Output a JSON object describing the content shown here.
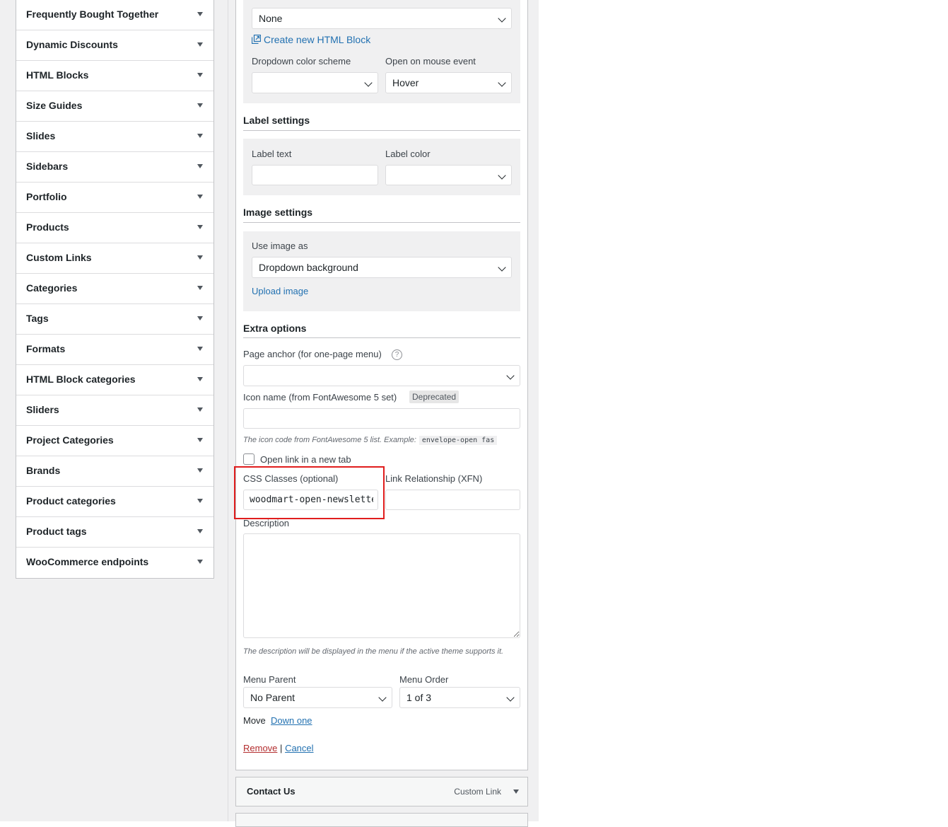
{
  "sidebar": {
    "items": [
      {
        "label": "Frequently Bought Together"
      },
      {
        "label": "Dynamic Discounts"
      },
      {
        "label": "HTML Blocks"
      },
      {
        "label": "Size Guides"
      },
      {
        "label": "Slides"
      },
      {
        "label": "Sidebars"
      },
      {
        "label": "Portfolio"
      },
      {
        "label": "Products"
      },
      {
        "label": "Custom Links"
      },
      {
        "label": "Categories"
      },
      {
        "label": "Tags"
      },
      {
        "label": "Formats"
      },
      {
        "label": "HTML Block categories"
      },
      {
        "label": "Sliders"
      },
      {
        "label": "Project Categories"
      },
      {
        "label": "Brands"
      },
      {
        "label": "Product categories"
      },
      {
        "label": "Product tags"
      },
      {
        "label": "WooCommerce endpoints"
      }
    ]
  },
  "menu_item": {
    "html_block_select": "None",
    "create_html_block": "Create new HTML Block",
    "dropdown_color_label": "Dropdown color scheme",
    "dropdown_color_value": "",
    "mouse_event_label": "Open on mouse event",
    "mouse_event_value": "Hover",
    "label_settings_title": "Label settings",
    "label_text_label": "Label text",
    "label_text_value": "",
    "label_color_label": "Label color",
    "label_color_value": "",
    "image_settings_title": "Image settings",
    "use_image_label": "Use image as",
    "use_image_value": "Dropdown background",
    "upload_image": "Upload image",
    "extra_options_title": "Extra options",
    "page_anchor_label": "Page anchor (for one-page menu)",
    "help_glyph": "?",
    "page_anchor_value": "",
    "icon_name_label": "Icon name (from FontAwesome 5 set)",
    "deprecated_badge": "Deprecated",
    "icon_note": "The icon code from FontAwesome 5 list. Example:",
    "icon_example": "envelope-open fas",
    "open_new_tab_label": "Open link in a new tab",
    "css_classes_label": "CSS Classes (optional)",
    "css_classes_value": "woodmart-open-newsletter",
    "xfn_label": "Link Relationship (XFN)",
    "xfn_value": "",
    "description_label": "Description",
    "description_note": "The description will be displayed in the menu if the active theme supports it.",
    "menu_parent_label": "Menu Parent",
    "menu_parent_value": "No Parent",
    "menu_order_label": "Menu Order",
    "menu_order_value": "1 of 3",
    "move_label": "Move",
    "down_one": "Down one",
    "remove": "Remove",
    "separator": "|",
    "cancel": "Cancel"
  },
  "next_item": {
    "title": "Contact Us",
    "type": "Custom Link"
  },
  "colors": {
    "link": "#2271b1",
    "remove": "#b32d2e",
    "highlight": "#e01d1d"
  }
}
